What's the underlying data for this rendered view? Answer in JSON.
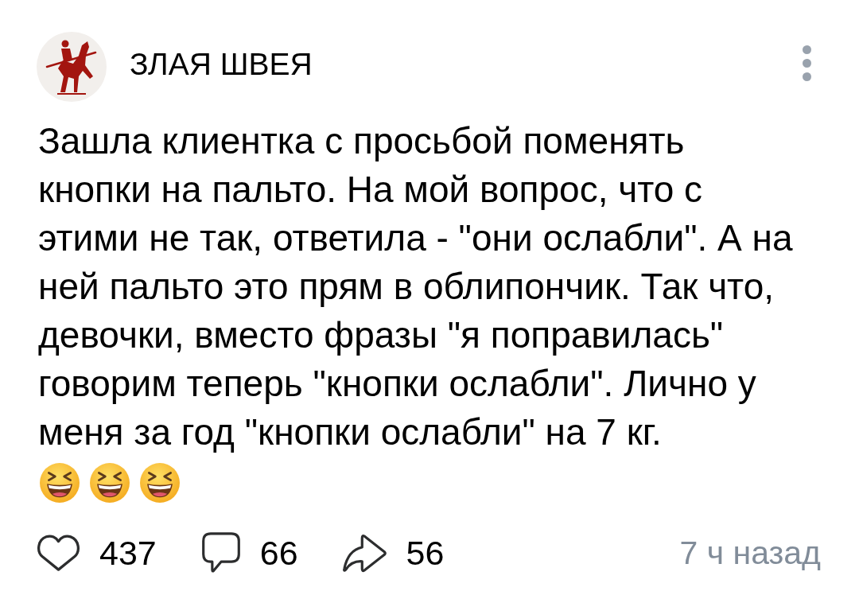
{
  "post": {
    "author": {
      "name": "ЗЛАЯ ШВЕЯ"
    },
    "text": "Зашла клиентка с просьбой поменять кнопки на пальто. На мой вопрос, что с этими не так, ответила - \"они ослабли\". А на ней пальто это прям в облипончик. Так что, девочки, вместо фразы \"я поправилась\" говорим теперь \"кнопки ослабли\". Лично у меня за год \"кнопки ослабли\" на 7 кг.",
    "emojis": [
      {
        "kind": "laughing"
      },
      {
        "kind": "laughing"
      },
      {
        "kind": "laughing"
      }
    ],
    "actions": [
      {
        "kind": "like",
        "count": "437"
      },
      {
        "kind": "comment",
        "count": "66"
      },
      {
        "kind": "share",
        "count": "56"
      }
    ],
    "time": "7 ч назад"
  }
}
